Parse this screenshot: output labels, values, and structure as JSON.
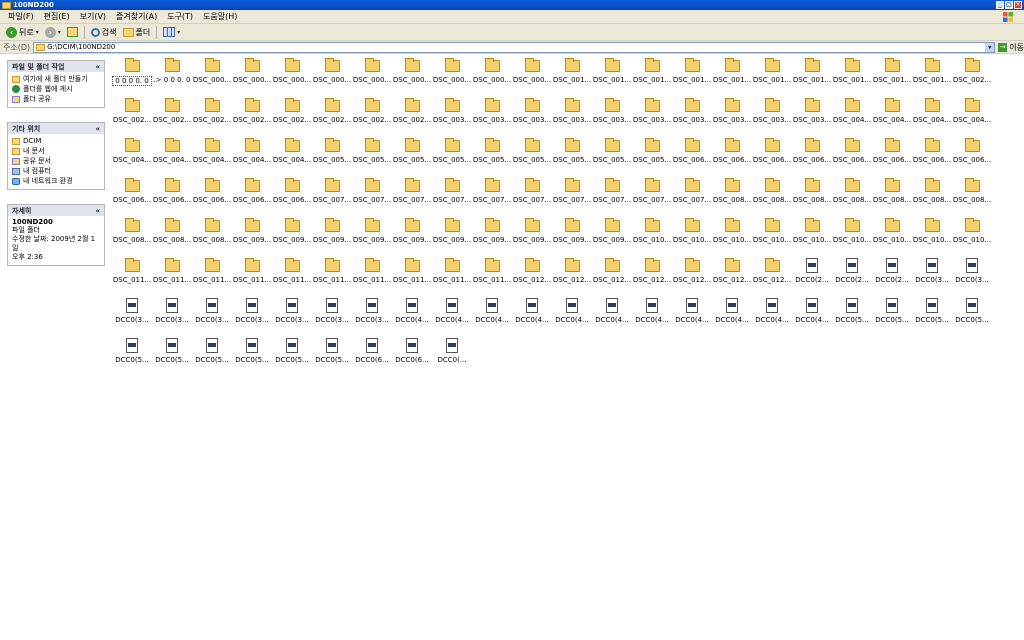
{
  "window": {
    "title": "100ND200"
  },
  "menu": [
    "파일(F)",
    "편집(E)",
    "보기(V)",
    "즐겨찾기(A)",
    "도구(T)",
    "도움말(H)"
  ],
  "toolbar": {
    "back": "뒤로",
    "search": "검색",
    "folders": "폴더"
  },
  "address": {
    "label": "주소(D)",
    "path": "G:\\DCIM\\100ND200",
    "go": "이동"
  },
  "tasks": {
    "title": "파일 및 폴더 작업",
    "items": [
      "여기에 새 폴더 만들기",
      "폴더를 웹에 게시",
      "폴더 공유"
    ]
  },
  "places": {
    "title": "기타 위치",
    "items": [
      "DCIM",
      "내 문서",
      "공유 문서",
      "내 컴퓨터",
      "내 네트워크 환경"
    ]
  },
  "details": {
    "title": "자세히",
    "name": "100ND200",
    "type": "파일 폴더",
    "modified": "수정한 날짜: 2009년 2월 1일",
    "time": "오후 2:36"
  },
  "items": [
    {
      "name": "0 0 0 0. 0",
      "kind": "folder"
    },
    {
      "name": ".> 0 0 0. 0",
      "kind": "folder"
    },
    {
      "name": "DSC_000...",
      "kind": "folder"
    },
    {
      "name": "DSC_000...",
      "kind": "folder"
    },
    {
      "name": "DSC_000...",
      "kind": "folder"
    },
    {
      "name": "DSC_000...",
      "kind": "folder"
    },
    {
      "name": "DSC_000...",
      "kind": "folder"
    },
    {
      "name": "DSC_000...",
      "kind": "folder"
    },
    {
      "name": "DSC_000...",
      "kind": "folder"
    },
    {
      "name": "DSC_000...",
      "kind": "folder"
    },
    {
      "name": "DSC_000...",
      "kind": "folder"
    },
    {
      "name": "DSC_001...",
      "kind": "folder"
    },
    {
      "name": "DSC_001...",
      "kind": "folder"
    },
    {
      "name": "DSC_001...",
      "kind": "folder"
    },
    {
      "name": "DSC_001...",
      "kind": "folder"
    },
    {
      "name": "DSC_001...",
      "kind": "folder"
    },
    {
      "name": "DSC_001...",
      "kind": "folder"
    },
    {
      "name": "DSC_001...",
      "kind": "folder"
    },
    {
      "name": "DSC_001...",
      "kind": "folder"
    },
    {
      "name": "DSC_001...",
      "kind": "folder"
    },
    {
      "name": "DSC_001...",
      "kind": "folder"
    },
    {
      "name": "DSC_002...",
      "kind": "folder"
    },
    {
      "name": "DSC_002...",
      "kind": "folder"
    },
    {
      "name": "DSC_002...",
      "kind": "folder"
    },
    {
      "name": "DSC_002...",
      "kind": "folder"
    },
    {
      "name": "DSC_002...",
      "kind": "folder"
    },
    {
      "name": "DSC_002...",
      "kind": "folder"
    },
    {
      "name": "DSC_002...",
      "kind": "folder"
    },
    {
      "name": "DSC_002...",
      "kind": "folder"
    },
    {
      "name": "DSC_002...",
      "kind": "folder"
    },
    {
      "name": "DSC_003...",
      "kind": "folder"
    },
    {
      "name": "DSC_003...",
      "kind": "folder"
    },
    {
      "name": "DSC_003...",
      "kind": "folder"
    },
    {
      "name": "DSC_003...",
      "kind": "folder"
    },
    {
      "name": "DSC_003...",
      "kind": "folder"
    },
    {
      "name": "DSC_003...",
      "kind": "folder"
    },
    {
      "name": "DSC_003...",
      "kind": "folder"
    },
    {
      "name": "DSC_003...",
      "kind": "folder"
    },
    {
      "name": "DSC_003...",
      "kind": "folder"
    },
    {
      "name": "DSC_003...",
      "kind": "folder"
    },
    {
      "name": "DSC_004...",
      "kind": "folder"
    },
    {
      "name": "DSC_004...",
      "kind": "folder"
    },
    {
      "name": "DSC_004...",
      "kind": "folder"
    },
    {
      "name": "DSC_004...",
      "kind": "folder"
    },
    {
      "name": "DSC_004...",
      "kind": "folder"
    },
    {
      "name": "DSC_004...",
      "kind": "folder"
    },
    {
      "name": "DSC_004...",
      "kind": "folder"
    },
    {
      "name": "DSC_004...",
      "kind": "folder"
    },
    {
      "name": "DSC_004...",
      "kind": "folder"
    },
    {
      "name": "DSC_005...",
      "kind": "folder"
    },
    {
      "name": "DSC_005...",
      "kind": "folder"
    },
    {
      "name": "DSC_005...",
      "kind": "folder"
    },
    {
      "name": "DSC_005...",
      "kind": "folder"
    },
    {
      "name": "DSC_005...",
      "kind": "folder"
    },
    {
      "name": "DSC_005...",
      "kind": "folder"
    },
    {
      "name": "DSC_005...",
      "kind": "folder"
    },
    {
      "name": "DSC_005...",
      "kind": "folder"
    },
    {
      "name": "DSC_005...",
      "kind": "folder"
    },
    {
      "name": "DSC_006...",
      "kind": "folder"
    },
    {
      "name": "DSC_006...",
      "kind": "folder"
    },
    {
      "name": "DSC_006...",
      "kind": "folder"
    },
    {
      "name": "DSC_006...",
      "kind": "folder"
    },
    {
      "name": "DSC_006...",
      "kind": "folder"
    },
    {
      "name": "DSC_006...",
      "kind": "folder"
    },
    {
      "name": "DSC_006...",
      "kind": "folder"
    },
    {
      "name": "DSC_006...",
      "kind": "folder"
    },
    {
      "name": "DSC_006...",
      "kind": "folder"
    },
    {
      "name": "DSC_006...",
      "kind": "folder"
    },
    {
      "name": "DSC_006...",
      "kind": "folder"
    },
    {
      "name": "DSC_006...",
      "kind": "folder"
    },
    {
      "name": "DSC_006...",
      "kind": "folder"
    },
    {
      "name": "DSC_007...",
      "kind": "folder"
    },
    {
      "name": "DSC_007...",
      "kind": "folder"
    },
    {
      "name": "DSC_007...",
      "kind": "folder"
    },
    {
      "name": "DSC_007...",
      "kind": "folder"
    },
    {
      "name": "DSC_007...",
      "kind": "folder"
    },
    {
      "name": "DSC_007...",
      "kind": "folder"
    },
    {
      "name": "DSC_007...",
      "kind": "folder"
    },
    {
      "name": "DSC_007...",
      "kind": "folder"
    },
    {
      "name": "DSC_007...",
      "kind": "folder"
    },
    {
      "name": "DSC_007...",
      "kind": "folder"
    },
    {
      "name": "DSC_008...",
      "kind": "folder"
    },
    {
      "name": "DSC_008...",
      "kind": "folder"
    },
    {
      "name": "DSC_008...",
      "kind": "folder"
    },
    {
      "name": "DSC_008...",
      "kind": "folder"
    },
    {
      "name": "DSC_008...",
      "kind": "folder"
    },
    {
      "name": "DSC_008...",
      "kind": "folder"
    },
    {
      "name": "DSC_008...",
      "kind": "folder"
    },
    {
      "name": "DSC_008...",
      "kind": "folder"
    },
    {
      "name": "DSC_008...",
      "kind": "folder"
    },
    {
      "name": "DSC_008...",
      "kind": "folder"
    },
    {
      "name": "DSC_009...",
      "kind": "folder"
    },
    {
      "name": "DSC_009...",
      "kind": "folder"
    },
    {
      "name": "DSC_009...",
      "kind": "folder"
    },
    {
      "name": "DSC_009...",
      "kind": "folder"
    },
    {
      "name": "DSC_009...",
      "kind": "folder"
    },
    {
      "name": "DSC_009...",
      "kind": "folder"
    },
    {
      "name": "DSC_009...",
      "kind": "folder"
    },
    {
      "name": "DSC_009...",
      "kind": "folder"
    },
    {
      "name": "DSC_009...",
      "kind": "folder"
    },
    {
      "name": "DSC_009...",
      "kind": "folder"
    },
    {
      "name": "DSC_010...",
      "kind": "folder"
    },
    {
      "name": "DSC_010...",
      "kind": "folder"
    },
    {
      "name": "DSC_010...",
      "kind": "folder"
    },
    {
      "name": "DSC_010...",
      "kind": "folder"
    },
    {
      "name": "DSC_010...",
      "kind": "folder"
    },
    {
      "name": "DSC_010...",
      "kind": "folder"
    },
    {
      "name": "DSC_010...",
      "kind": "folder"
    },
    {
      "name": "DSC_010...",
      "kind": "folder"
    },
    {
      "name": "DSC_010...",
      "kind": "folder"
    },
    {
      "name": "DSC_011...",
      "kind": "folder"
    },
    {
      "name": "DSC_011...",
      "kind": "folder"
    },
    {
      "name": "DSC_011...",
      "kind": "folder"
    },
    {
      "name": "DSC_011...",
      "kind": "folder"
    },
    {
      "name": "DSC_011...",
      "kind": "folder"
    },
    {
      "name": "DSC_011...",
      "kind": "folder"
    },
    {
      "name": "DSC_011...",
      "kind": "folder"
    },
    {
      "name": "DSC_011...",
      "kind": "folder"
    },
    {
      "name": "DSC_011...",
      "kind": "folder"
    },
    {
      "name": "DSC_011...",
      "kind": "folder"
    },
    {
      "name": "DSC_012...",
      "kind": "folder"
    },
    {
      "name": "DSC_012...",
      "kind": "folder"
    },
    {
      "name": "DSC_012...",
      "kind": "folder"
    },
    {
      "name": "DSC_012...",
      "kind": "folder"
    },
    {
      "name": "DSC_012...",
      "kind": "folder"
    },
    {
      "name": "DSC_012...",
      "kind": "folder"
    },
    {
      "name": "DSC_012...",
      "kind": "folder"
    },
    {
      "name": "DCC0(2...",
      "kind": "file"
    },
    {
      "name": "DCC0(2...",
      "kind": "file"
    },
    {
      "name": "DCC0(2...",
      "kind": "file"
    },
    {
      "name": "DCC0(3...",
      "kind": "file"
    },
    {
      "name": "DCC0(3...",
      "kind": "file"
    },
    {
      "name": "DCC0(3...",
      "kind": "file"
    },
    {
      "name": "DCC0(3...",
      "kind": "file"
    },
    {
      "name": "DCC0(3...",
      "kind": "file"
    },
    {
      "name": "DCC0(3...",
      "kind": "file"
    },
    {
      "name": "DCC0(3...",
      "kind": "file"
    },
    {
      "name": "DCC0(3...",
      "kind": "file"
    },
    {
      "name": "DCC0(3...",
      "kind": "file"
    },
    {
      "name": "DCC0(4...",
      "kind": "file"
    },
    {
      "name": "DCC0(4...",
      "kind": "file"
    },
    {
      "name": "DCC0(4...",
      "kind": "file"
    },
    {
      "name": "DCC0(4...",
      "kind": "file"
    },
    {
      "name": "DCC0(4...",
      "kind": "file"
    },
    {
      "name": "DCC0(4...",
      "kind": "file"
    },
    {
      "name": "DCC0(4...",
      "kind": "file"
    },
    {
      "name": "DCC0(4...",
      "kind": "file"
    },
    {
      "name": "DCC0(4...",
      "kind": "file"
    },
    {
      "name": "DCC0(4...",
      "kind": "file"
    },
    {
      "name": "DCC0(4...",
      "kind": "file"
    },
    {
      "name": "DCC0(5...",
      "kind": "file"
    },
    {
      "name": "DCC0(5...",
      "kind": "file"
    },
    {
      "name": "DCC0(5...",
      "kind": "file"
    },
    {
      "name": "DCC0(5...",
      "kind": "file"
    },
    {
      "name": "DCC0(5...",
      "kind": "file"
    },
    {
      "name": "DCC0(5...",
      "kind": "file"
    },
    {
      "name": "DCC0(5...",
      "kind": "file"
    },
    {
      "name": "DCC0(5...",
      "kind": "file"
    },
    {
      "name": "DCC0(5...",
      "kind": "file"
    },
    {
      "name": "DCC0(5...",
      "kind": "file"
    },
    {
      "name": "DCC0(6...",
      "kind": "file"
    },
    {
      "name": "DCC0(6...",
      "kind": "file"
    },
    {
      "name": "DCC0(...",
      "kind": "file"
    }
  ]
}
